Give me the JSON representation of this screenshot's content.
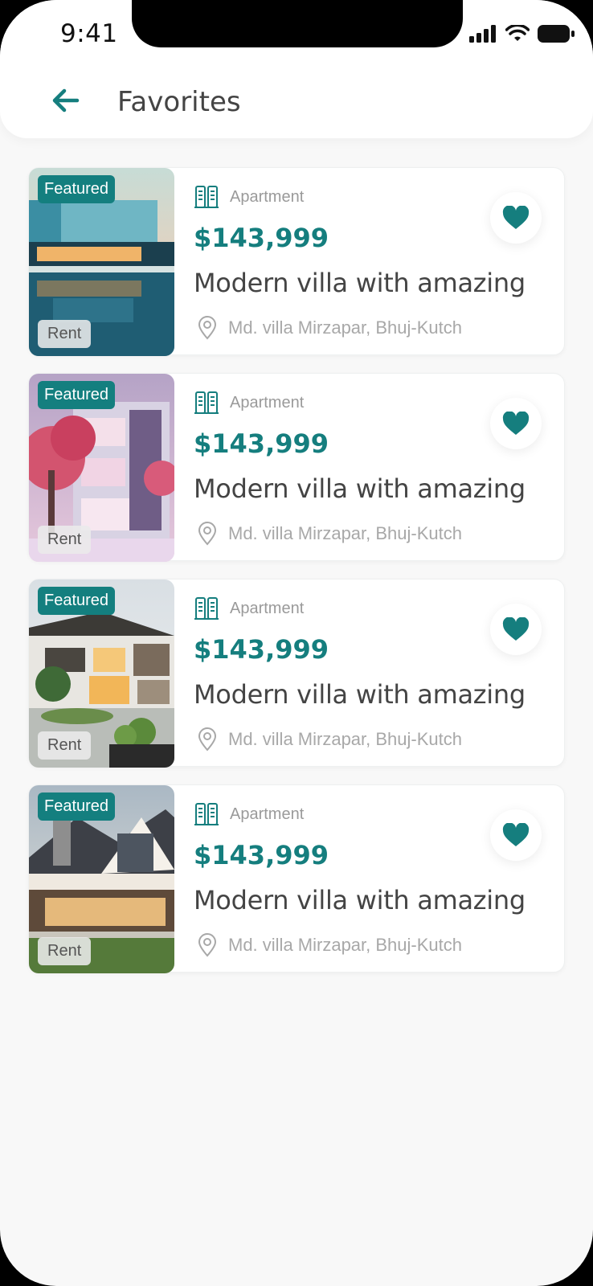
{
  "status_bar": {
    "time": "9:41"
  },
  "header": {
    "title": "Favorites"
  },
  "colors": {
    "accent": "#157e7e",
    "background": "#f8f8f8"
  },
  "listings": [
    {
      "badge": "Featured",
      "tag": "Rent",
      "type": "Apartment",
      "price": "$143,999",
      "title": "Modern villa with amazing",
      "address": "Md. villa Mirzapar, Bhuj-Kutch",
      "favorited": true
    },
    {
      "badge": "Featured",
      "tag": "Rent",
      "type": "Apartment",
      "price": "$143,999",
      "title": "Modern villa with amazing",
      "address": "Md. villa Mirzapar, Bhuj-Kutch",
      "favorited": true
    },
    {
      "badge": "Featured",
      "tag": "Rent",
      "type": "Apartment",
      "price": "$143,999",
      "title": "Modern villa with amazing",
      "address": "Md. villa Mirzapar, Bhuj-Kutch",
      "favorited": true
    },
    {
      "badge": "Featured",
      "tag": "Rent",
      "type": "Apartment",
      "price": "$143,999",
      "title": "Modern villa with amazing",
      "address": "Md. villa Mirzapar, Bhuj-Kutch",
      "favorited": true
    }
  ]
}
